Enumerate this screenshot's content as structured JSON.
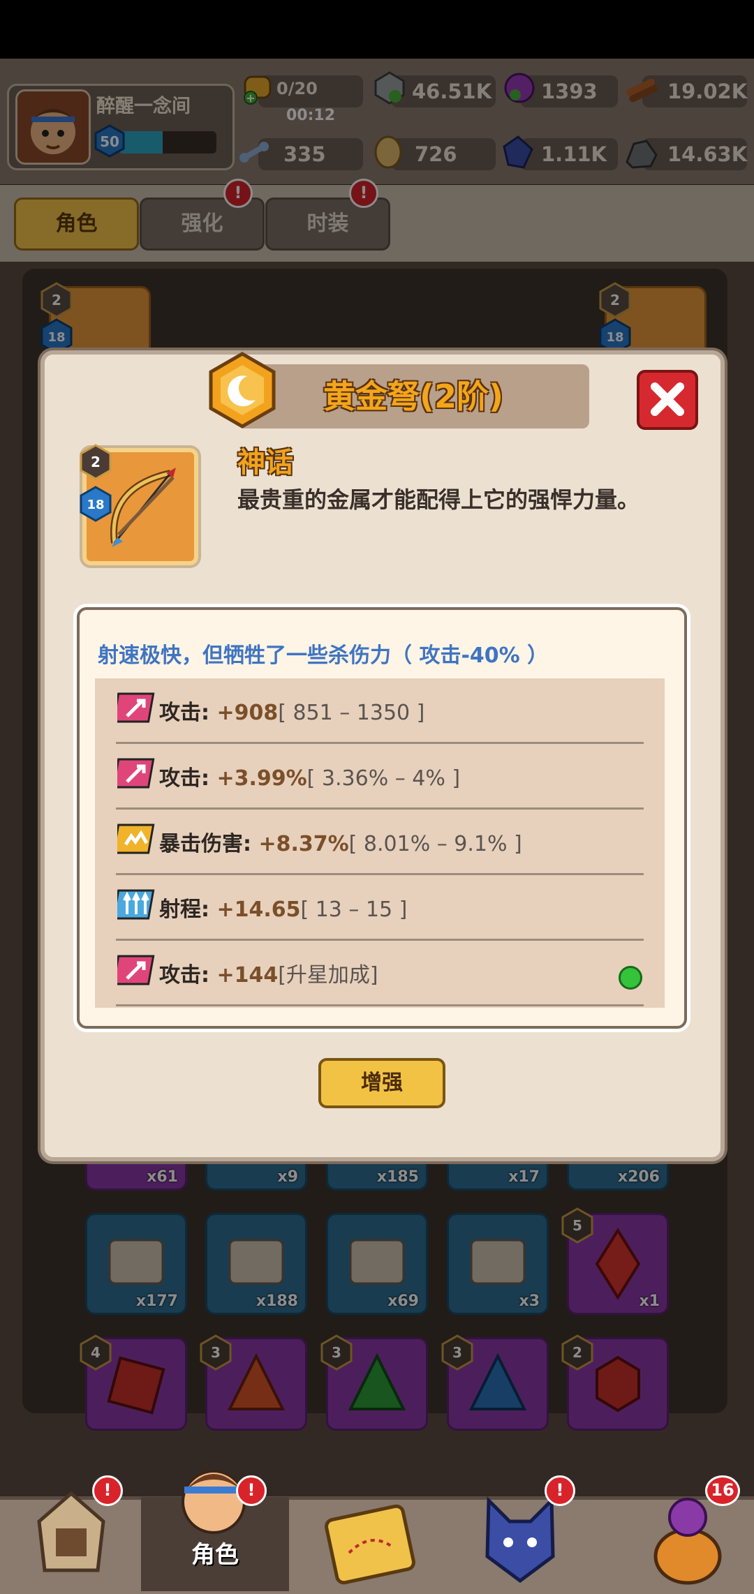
{
  "player": {
    "name": "醉醒一念间",
    "level": "50",
    "xp_fraction": 0.45
  },
  "resources": {
    "stamina": "0/20",
    "timer": "00:12",
    "silver": "46.51K",
    "gem_purple": "1393",
    "wood": "19.02K",
    "bone": "335",
    "gold_coin": "726",
    "crystal": "1.11K",
    "stone": "14.63K"
  },
  "tabs": [
    {
      "label": "角色",
      "active": true
    },
    {
      "label": "强化",
      "alert": "!"
    },
    {
      "label": "时装",
      "alert": "!"
    }
  ],
  "background": {
    "slot_badges": {
      "left_tier": "2",
      "left_level": "18",
      "right_tier": "2",
      "right_level": "18"
    },
    "row1_counts": [
      "x61",
      "x9",
      "x185",
      "x17",
      "x206"
    ],
    "row2_counts": [
      "x177",
      "x188",
      "x69",
      "x3",
      "x1"
    ],
    "row2_badge": "5",
    "row3_badges": [
      "4",
      "3",
      "3",
      "3",
      "2"
    ]
  },
  "modal": {
    "title": "黄金弩(2阶)",
    "rarity": "神话",
    "description": "最贵重的金属才能配得上它的强悍力量。",
    "item_tier": "2",
    "item_level": "18",
    "stat_note": "射速极快，但牺牲了一些杀伤力（ 攻击-40% ）",
    "stats": [
      {
        "icon": "attack-icon",
        "label": "攻击:",
        "value": " +908",
        "range": "[ 851 – 1350 ]"
      },
      {
        "icon": "attack-icon",
        "label": "攻击:",
        "value": " +3.99%",
        "range": "[ 3.36% – 4% ]"
      },
      {
        "icon": "crit-damage-icon",
        "label": "暴击伤害:",
        "value": " +8.37%",
        "range": "[ 8.01% – 9.1% ]"
      },
      {
        "icon": "range-icon",
        "label": "射程:",
        "value": " +14.65",
        "range": "[ 13 – 15 ]"
      },
      {
        "icon": "attack-icon",
        "label": "攻击:",
        "value": " +144",
        "range": "[升星加成]"
      }
    ],
    "enhance_label": "增强"
  },
  "bottom_nav": {
    "selected_label": "角色",
    "badges": {
      "hero": "!",
      "character": "!",
      "pet": "!",
      "bag": "16"
    }
  },
  "colors": {
    "accent_gold": "#f4c54a",
    "alert_red": "#d8232a",
    "note_blue": "#3f74c2"
  }
}
